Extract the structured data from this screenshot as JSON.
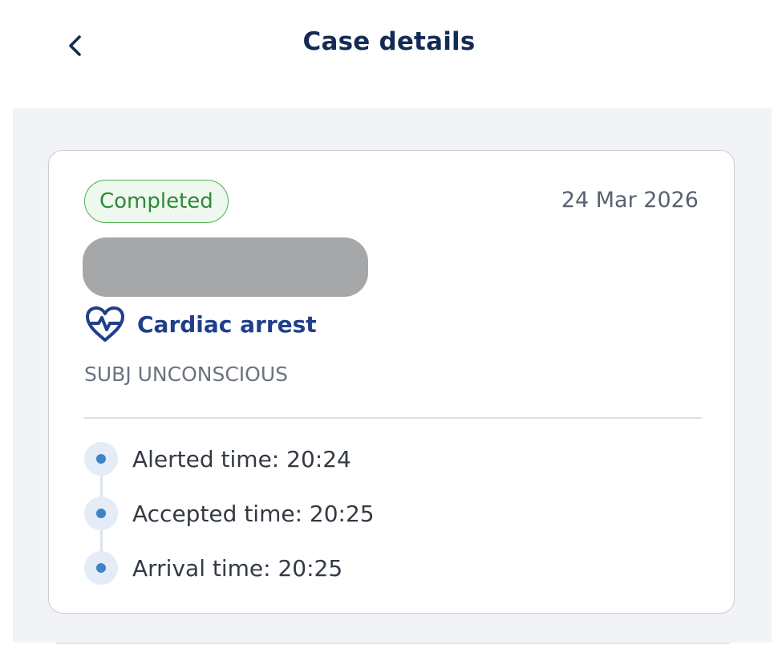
{
  "header": {
    "title": "Case details",
    "back_icon": "chevron-left-icon"
  },
  "case": {
    "status": "Completed",
    "date": "24 Mar 2026",
    "type_icon": "heart-pulse-icon",
    "type": "Cardiac arrest",
    "description": "SUBJ UNCONSCIOUS",
    "timeline": [
      {
        "label": "Alerted time: 20:24"
      },
      {
        "label": "Accepted time: 20:25"
      },
      {
        "label": "Arrival time: 20:25"
      }
    ]
  },
  "colors": {
    "title": "#152a55",
    "accent": "#1f3f8a",
    "status_green": "#2c8a35",
    "timeline_dot": "#3f82c9",
    "content_background": "#f1f3f7"
  }
}
